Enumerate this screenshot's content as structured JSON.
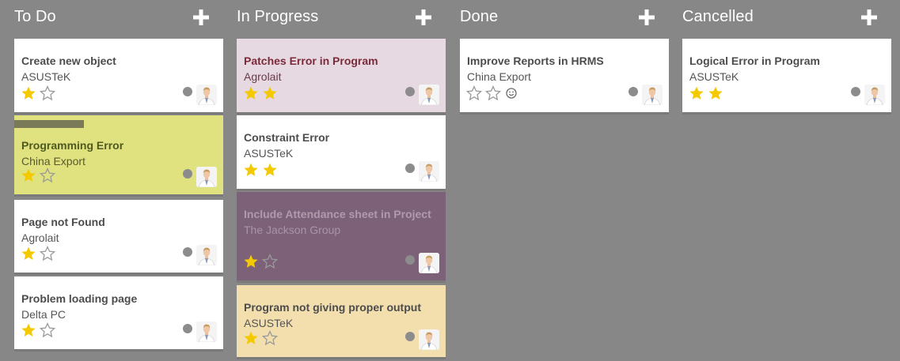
{
  "columns": [
    {
      "title": "To Do",
      "cards": [
        {
          "title": "Create new object",
          "customer": "ASUSTeK",
          "stars": 1
        },
        {
          "title": "Programming Error",
          "customer": "China Export",
          "stars": 1
        },
        {
          "title": "Page not Found",
          "customer": "Agrolait",
          "stars": 1
        },
        {
          "title": "Problem loading page",
          "customer": "Delta PC",
          "stars": 1
        }
      ]
    },
    {
      "title": "In Progress",
      "cards": [
        {
          "title": "Patches Error in Program",
          "customer": "Agrolait",
          "stars": 2
        },
        {
          "title": "Constraint Error",
          "customer": "ASUSTeK",
          "stars": 2
        },
        {
          "title": "Include Attendance sheet in Project",
          "customer": "The Jackson Group",
          "stars": 1
        },
        {
          "title": "Program not giving proper output",
          "customer": "ASUSTeK",
          "stars": 1
        }
      ]
    },
    {
      "title": "Done",
      "cards": [
        {
          "title": "Improve Reports in HRMS",
          "customer": "China Export",
          "stars": 0
        }
      ]
    },
    {
      "title": "Cancelled",
      "cards": [
        {
          "title": "Logical Error in Program",
          "customer": "ASUSTeK",
          "stars": 2
        }
      ]
    }
  ],
  "colors": {
    "background": "#878787",
    "star_filled": "#f5c900",
    "star_empty": "#9a9a9a",
    "status_dot": "#8c8c8c",
    "card_pink": "#e6d9e1",
    "card_yellow_green": "#dfe27f",
    "card_purple": "#7d6179",
    "card_tan": "#f3dfae"
  },
  "icons": {
    "add": "plus-icon",
    "star": "star-icon",
    "smiley": "smiley-icon",
    "avatar": "user-avatar"
  }
}
